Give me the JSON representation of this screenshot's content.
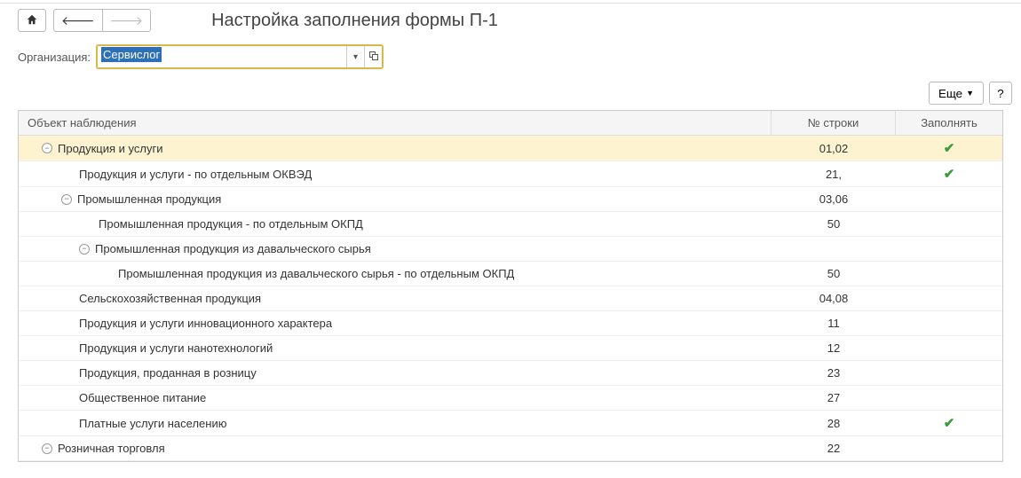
{
  "title": "Настройка заполнения формы П-1",
  "toolbar": {
    "home_title": "Домой",
    "back_title": "Назад",
    "forward_title": "Вперед"
  },
  "org": {
    "label": "Организация:",
    "value": "Сервислог"
  },
  "actions": {
    "more_label": "Еще",
    "help_label": "?"
  },
  "grid": {
    "headers": {
      "name": "Объект наблюдения",
      "num": "№ строки",
      "fill": "Заполнять"
    },
    "rows": [
      {
        "level": 0,
        "toggle": "−",
        "label": "Продукция и услуги",
        "num": "01,02",
        "fill": true,
        "selected": true
      },
      {
        "level": 1,
        "toggle": "",
        "label": "Продукция и услуги - по отдельным ОКВЭД",
        "num": "21,",
        "fill": true
      },
      {
        "level": 1,
        "toggle": "−",
        "label": "Промышленная продукция",
        "num": "03,06",
        "fill": false
      },
      {
        "level": 2,
        "toggle": "",
        "label": "Промышленная продукция - по отдельным ОКПД",
        "num": "50",
        "fill": false
      },
      {
        "level": 2,
        "toggle": "−",
        "label": "Промышленная продукция из давальческого сырья",
        "num": "",
        "fill": false
      },
      {
        "level": 3,
        "toggle": "",
        "label": "Промышленная продукция из давальческого сырья - по отдельным ОКПД",
        "num": "50",
        "fill": false
      },
      {
        "level": 1,
        "toggle": "",
        "label": "Сельскохозяйственная продукция",
        "num": "04,08",
        "fill": false
      },
      {
        "level": 1,
        "toggle": "",
        "label": "Продукция и услуги инновационного характера",
        "num": "11",
        "fill": false
      },
      {
        "level": 1,
        "toggle": "",
        "label": "Продукция и услуги нанотехнологий",
        "num": "12",
        "fill": false
      },
      {
        "level": 1,
        "toggle": "",
        "label": "Продукция, проданная в розницу",
        "num": "23",
        "fill": false
      },
      {
        "level": 1,
        "toggle": "",
        "label": "Общественное питание",
        "num": "27",
        "fill": false
      },
      {
        "level": 1,
        "toggle": "",
        "label": "Платные услуги населению",
        "num": "28",
        "fill": true
      },
      {
        "level": 0,
        "toggle": "−",
        "label": "Розничная торговля",
        "num": "22",
        "fill": false
      }
    ]
  }
}
